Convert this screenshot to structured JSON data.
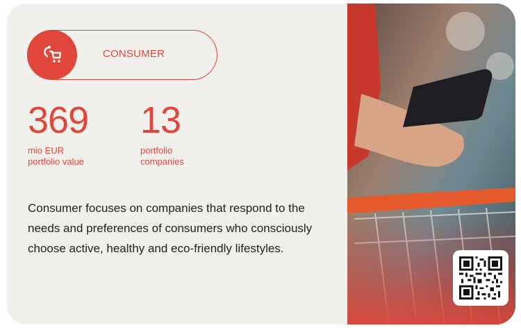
{
  "category": {
    "label": "CONSUMER",
    "icon": "shopping-cart-person-icon",
    "accent_color": "#e0473a"
  },
  "stats": [
    {
      "value": "369",
      "label_line1": "mio EUR",
      "label_line2": "portfolio value"
    },
    {
      "value": "13",
      "label_line1": "portfolio",
      "label_line2": "companies"
    }
  ],
  "description": "Consumer focuses on companies that respond to the needs and preferences of consumers who consciously choose active, healthy and eco-friendly lifestyles.",
  "photo": {
    "subject": "hand holding smartphone over shopping cart"
  },
  "qr": {
    "icon": "qr-code-icon"
  }
}
